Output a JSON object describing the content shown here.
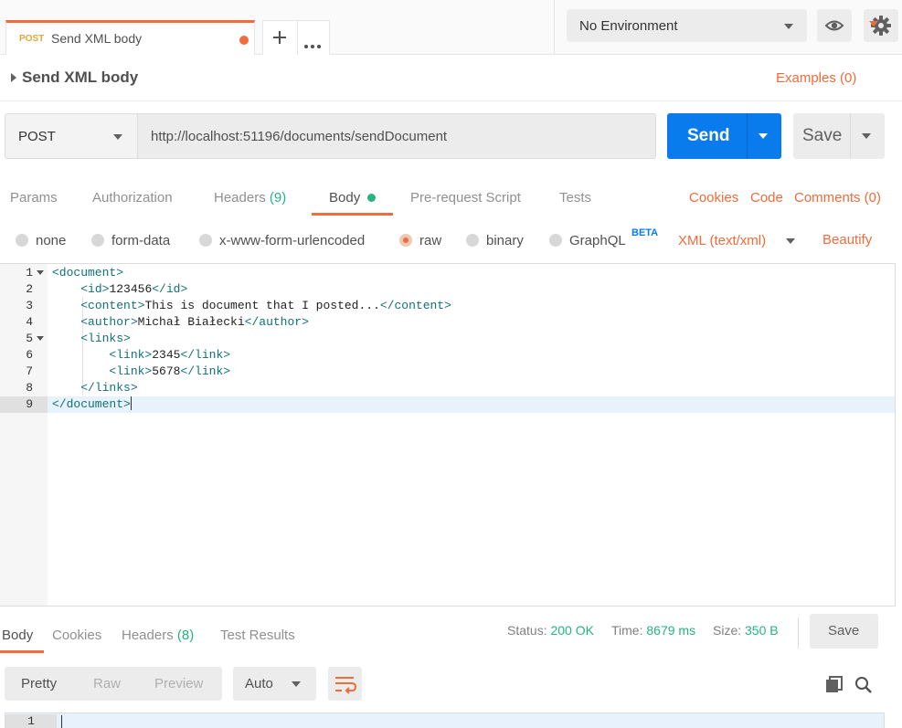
{
  "top_tab": {
    "method": "POST",
    "name": "Send XML body"
  },
  "environment": {
    "selected": "No Environment"
  },
  "request": {
    "title": "Send XML body",
    "examples_label": "Examples (0)",
    "method": "POST",
    "url": "http://localhost:51196/documents/sendDocument",
    "send_label": "Send",
    "save_label": "Save"
  },
  "request_tabs": {
    "params": "Params",
    "authorization": "Authorization",
    "headers": "Headers",
    "headers_count": "(9)",
    "body": "Body",
    "prerequest": "Pre-request Script",
    "tests": "Tests",
    "cookies": "Cookies",
    "code": "Code",
    "comments": "Comments (0)"
  },
  "body_types": {
    "none": "none",
    "form_data": "form-data",
    "urlencoded": "x-www-form-urlencoded",
    "raw": "raw",
    "binary": "binary",
    "graphql": "GraphQL",
    "beta": "BETA",
    "content_type": "XML (text/xml)",
    "beautify": "Beautify"
  },
  "editor": {
    "line_numbers": [
      "1",
      "2",
      "3",
      "4",
      "5",
      "6",
      "7",
      "8",
      "9"
    ],
    "lines": {
      "l1_tag": "<document>",
      "l2_open": "<id>",
      "l2_text": "123456",
      "l2_close": "</id>",
      "l3_open": "<content>",
      "l3_text": "This is document that I posted...",
      "l3_close": "</content>",
      "l4_open": "<author>",
      "l4_text": "Michał Białecki",
      "l4_close": "</author>",
      "l5_tag": "<links>",
      "l6_open": "<link>",
      "l6_text": "2345",
      "l6_close": "</link>",
      "l7_open": "<link>",
      "l7_text": "5678",
      "l7_close": "</link>",
      "l8_tag": "</links>",
      "l9_tag": "</document>"
    }
  },
  "response": {
    "tabs": {
      "body": "Body",
      "cookies": "Cookies",
      "headers": "Headers",
      "headers_count": "(8)",
      "test_results": "Test Results"
    },
    "status_label": "Status:",
    "status_value": "200 OK",
    "time_label": "Time:",
    "time_value": "8679 ms",
    "size_label": "Size:",
    "size_value": "350 B",
    "save_label": "Save",
    "view_modes": [
      "Pretty",
      "Raw",
      "Preview"
    ],
    "format": "Auto",
    "first_line_number": "1"
  },
  "colors": {
    "accent": "#f26b3a",
    "send_blue": "#097bed",
    "success_green": "#26b47f"
  }
}
